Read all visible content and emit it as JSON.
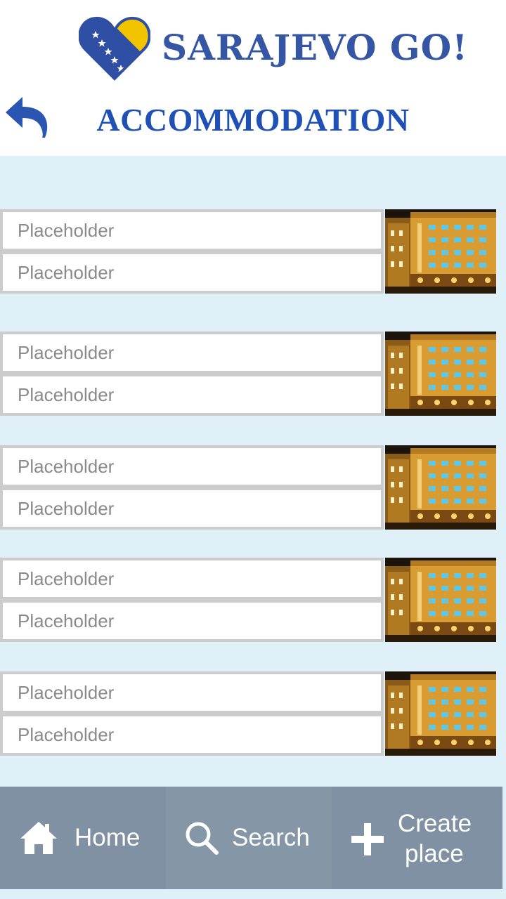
{
  "header": {
    "brand": "SARAJEVO GO!",
    "title": "ACCOMMODATION"
  },
  "icons": {
    "logo": "heart-flag-icon",
    "back": "back-arrow-icon",
    "home": "home-icon",
    "search": "search-icon",
    "create": "plus-icon"
  },
  "listings": [
    {
      "field1_placeholder": "Placeholder",
      "field2_placeholder": "Placeholder",
      "image": "hotel-photo"
    },
    {
      "field1_placeholder": "Placeholder",
      "field2_placeholder": "Placeholder",
      "image": "hotel-photo"
    },
    {
      "field1_placeholder": "Placeholder",
      "field2_placeholder": "Placeholder",
      "image": "hotel-photo"
    },
    {
      "field1_placeholder": "Placeholder",
      "field2_placeholder": "Placeholder",
      "image": "hotel-photo"
    },
    {
      "field1_placeholder": "Placeholder",
      "field2_placeholder": "Placeholder",
      "image": "hotel-photo"
    }
  ],
  "nav": {
    "home": "Home",
    "search": "Search",
    "create_line1": "Create",
    "create_line2": "place"
  },
  "colors": {
    "accent": "#1f50b6",
    "background": "#dff0f8",
    "nav": "#8091a3"
  }
}
